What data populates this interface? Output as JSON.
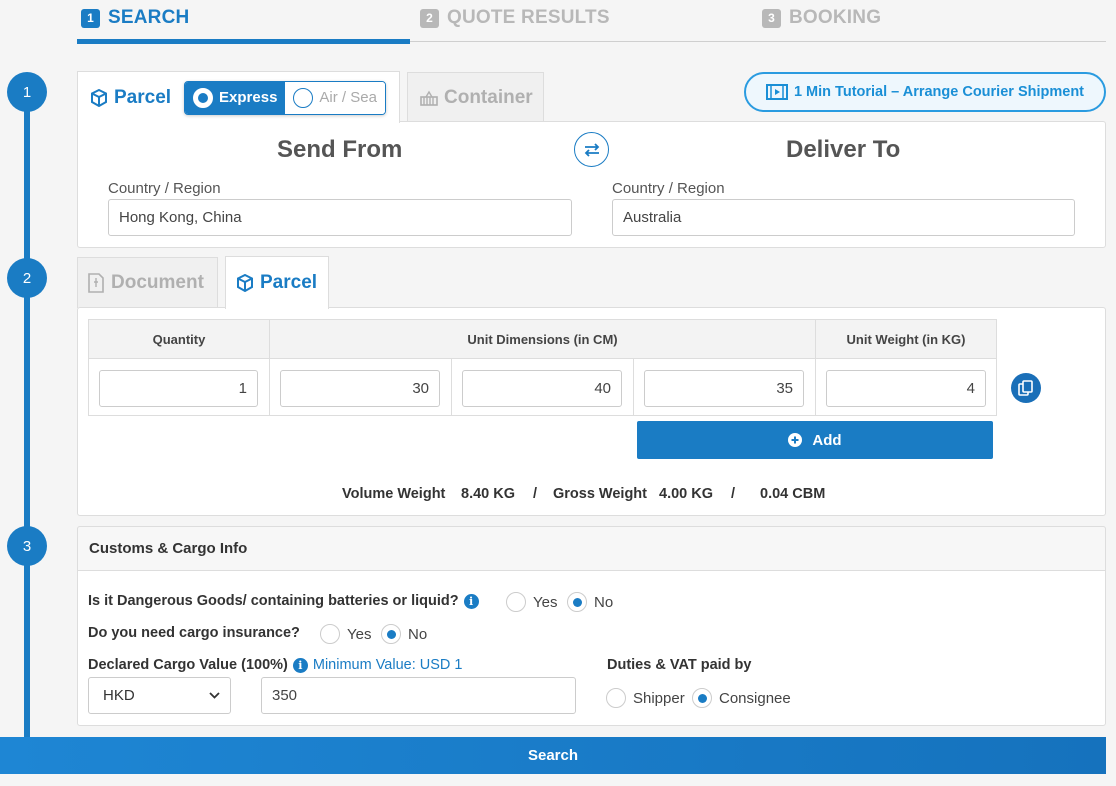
{
  "steps": [
    {
      "num": "1",
      "label": "SEARCH",
      "active": true
    },
    {
      "num": "2",
      "label": "QUOTE RESULTS",
      "active": false
    },
    {
      "num": "3",
      "label": "BOOKING",
      "active": false
    }
  ],
  "timeline": [
    "1",
    "2",
    "3"
  ],
  "shipment_tabs": {
    "parcel": "Parcel",
    "express": "Express",
    "air_sea": "Air / Sea",
    "container": "Container"
  },
  "tutorial": "1 Min Tutorial – Arrange Courier Shipment",
  "route": {
    "from_title": "Send From",
    "to_title": "Deliver To",
    "from_label": "Country / Region",
    "from_value": "Hong Kong, China",
    "to_label": "Country / Region",
    "to_value": "Australia"
  },
  "cargo_tabs": {
    "document": "Document",
    "parcel": "Parcel"
  },
  "dimensions": {
    "headers": {
      "quantity": "Quantity",
      "dims": "Unit Dimensions (in CM)",
      "weight": "Unit Weight (in KG)"
    },
    "row": {
      "quantity": "1",
      "length": "30",
      "width": "40",
      "height": "35",
      "weight": "4"
    },
    "add_label": "Add"
  },
  "summary": {
    "volume_label": "Volume Weight",
    "volume_value": "8.40 KG",
    "sep1": "/",
    "gross_label": "Gross Weight",
    "gross_value": "4.00 KG",
    "sep2": "/",
    "cbm": "0.04 CBM"
  },
  "customs": {
    "title": "Customs & Cargo Info",
    "dangerous_q": "Is it Dangerous Goods/ containing batteries or liquid?",
    "dangerous_yes": "Yes",
    "dangerous_no": "No",
    "insurance_q": "Do you need cargo insurance?",
    "insurance_yes": "Yes",
    "insurance_no": "No",
    "declared_label": "Declared Cargo Value (100%)",
    "min_value": "Minimum Value: USD 1",
    "currency": "HKD",
    "value": "350",
    "duties_label": "Duties & VAT paid by",
    "shipper": "Shipper",
    "consignee": "Consignee"
  },
  "search_label": "Search",
  "colors": {
    "accent": "#1a7cc4",
    "inactive": "#b8b8b8"
  }
}
